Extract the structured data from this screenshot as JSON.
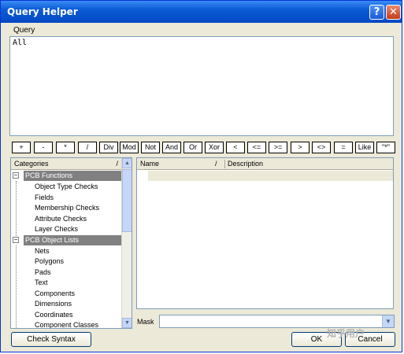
{
  "window": {
    "title": "Query Helper",
    "help_glyph": "?",
    "close_glyph": "✕"
  },
  "query": {
    "label": "Query",
    "value": "All"
  },
  "operators": [
    "+",
    "-",
    "*",
    "/",
    "Div",
    "Mod",
    "Not",
    "And",
    "Or",
    "Xor",
    "<",
    "<=",
    ">=",
    ">",
    "<>",
    "=",
    "Like",
    "\"*\""
  ],
  "categories": {
    "header": "Categories",
    "sort_glyph": "/",
    "groups": [
      {
        "label": "PCB Functions",
        "expander": "−",
        "items": [
          "Object Type Checks",
          "Fields",
          "Membership Checks",
          "Attribute Checks",
          "Layer Checks"
        ]
      },
      {
        "label": "PCB Object Lists",
        "expander": "−",
        "items": [
          "Nets",
          "Polygons",
          "Pads",
          "Text",
          "Components",
          "Dimensions",
          "Coordinates",
          "Component Classes"
        ]
      }
    ]
  },
  "list": {
    "col_name": "Name",
    "col_sort": "/",
    "col_description": "Description"
  },
  "mask": {
    "label": "Mask",
    "value": ""
  },
  "buttons": {
    "check_syntax": "Check Syntax",
    "ok": "OK",
    "cancel": "Cancel"
  },
  "watermark": "知乎用户"
}
